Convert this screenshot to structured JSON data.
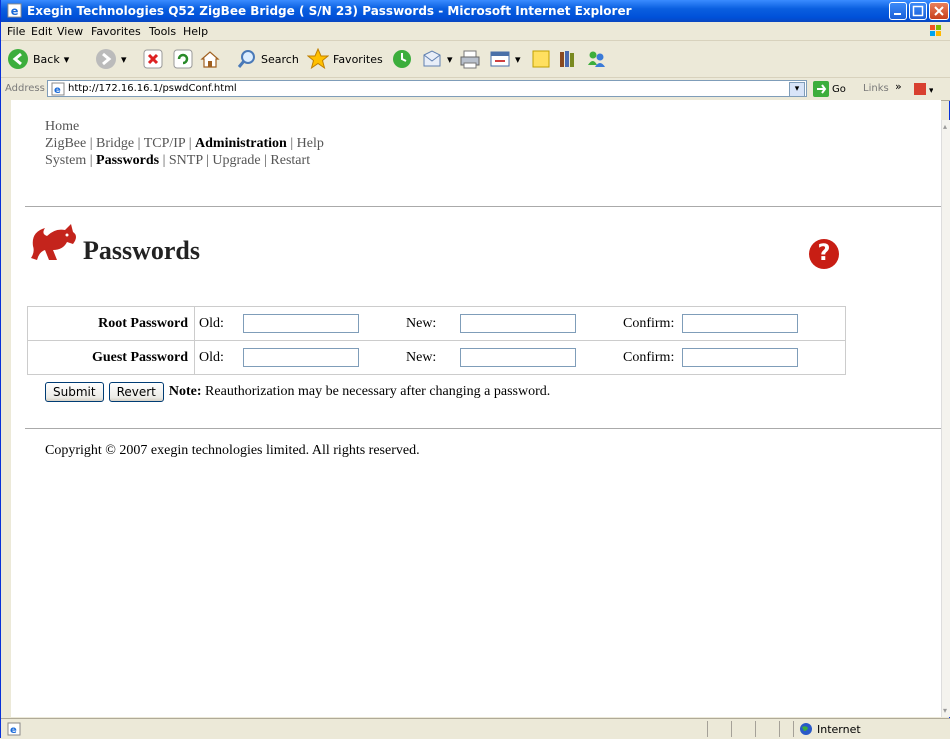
{
  "window": {
    "title": "Exegin Technologies Q52 ZigBee Bridge ( S/N 23) Passwords - Microsoft Internet Explorer"
  },
  "menu": [
    "File",
    "Edit",
    "View",
    "Favorites",
    "Tools",
    "Help"
  ],
  "toolbar": {
    "back": "Back",
    "search": "Search",
    "favorites": "Favorites"
  },
  "address": {
    "label": "Address",
    "url": "http://172.16.16.1/pswdConf.html",
    "go": "Go",
    "links": "Links"
  },
  "nav": {
    "home": "Home",
    "row1": [
      "ZigBee",
      "Bridge",
      "TCP/IP",
      "Administration",
      "Help"
    ],
    "row2": [
      "System",
      "Passwords",
      "SNTP",
      "Upgrade",
      "Restart"
    ],
    "sep": "|"
  },
  "page": {
    "title": "Passwords",
    "help_glyph": "?"
  },
  "form": {
    "rows": [
      {
        "label": "Root Password",
        "old": "Old:",
        "new": "New:",
        "confirm": "Confirm:"
      },
      {
        "label": "Guest Password",
        "old": "Old:",
        "new": "New:",
        "confirm": "Confirm:"
      }
    ],
    "submit": "Submit",
    "revert": "Revert",
    "note_label": "Note:",
    "note_text": "Reauthorization may be necessary after changing a password."
  },
  "footer": {
    "copyright": "Copyright © 2007 exegin technologies limited. All rights reserved."
  },
  "status": {
    "zone": "Internet"
  }
}
